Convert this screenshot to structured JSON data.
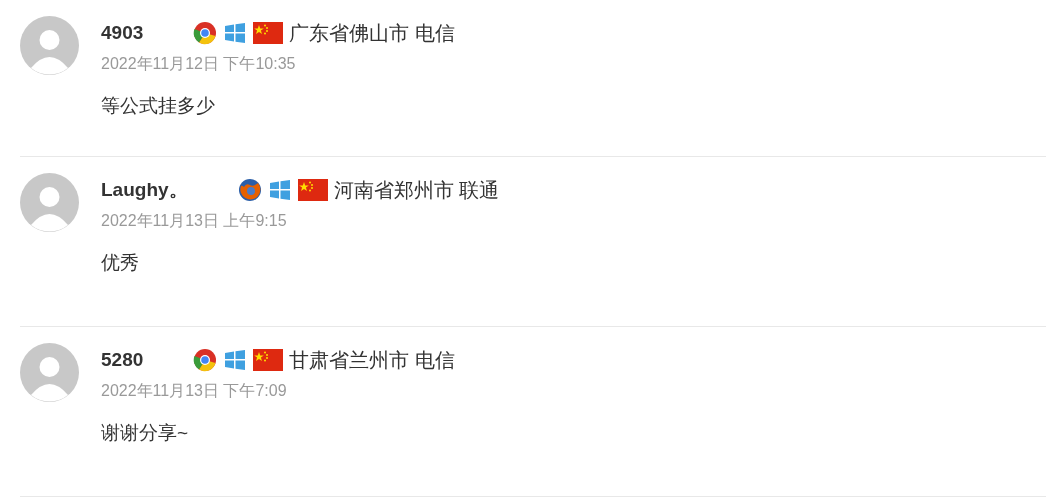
{
  "comments": [
    {
      "author": "4903",
      "icons": [
        {
          "kind": "chrome"
        },
        {
          "kind": "windows"
        },
        {
          "kind": "flag"
        }
      ],
      "location": "广东省佛山市 电信",
      "date": "2022年11月12日 下午10:35",
      "text": "等公式挂多少"
    },
    {
      "author": "Laughy。",
      "icons": [
        {
          "kind": "firefox"
        },
        {
          "kind": "windows"
        },
        {
          "kind": "flag"
        }
      ],
      "location": "河南省郑州市 联通",
      "date": "2022年11月13日 上午9:15",
      "text": "优秀"
    },
    {
      "author": "5280",
      "icons": [
        {
          "kind": "chrome"
        },
        {
          "kind": "windows"
        },
        {
          "kind": "flag"
        }
      ],
      "location": "甘肃省兰州市 电信",
      "date": "2022年11月13日 下午7:09",
      "text": "谢谢分享~"
    }
  ]
}
